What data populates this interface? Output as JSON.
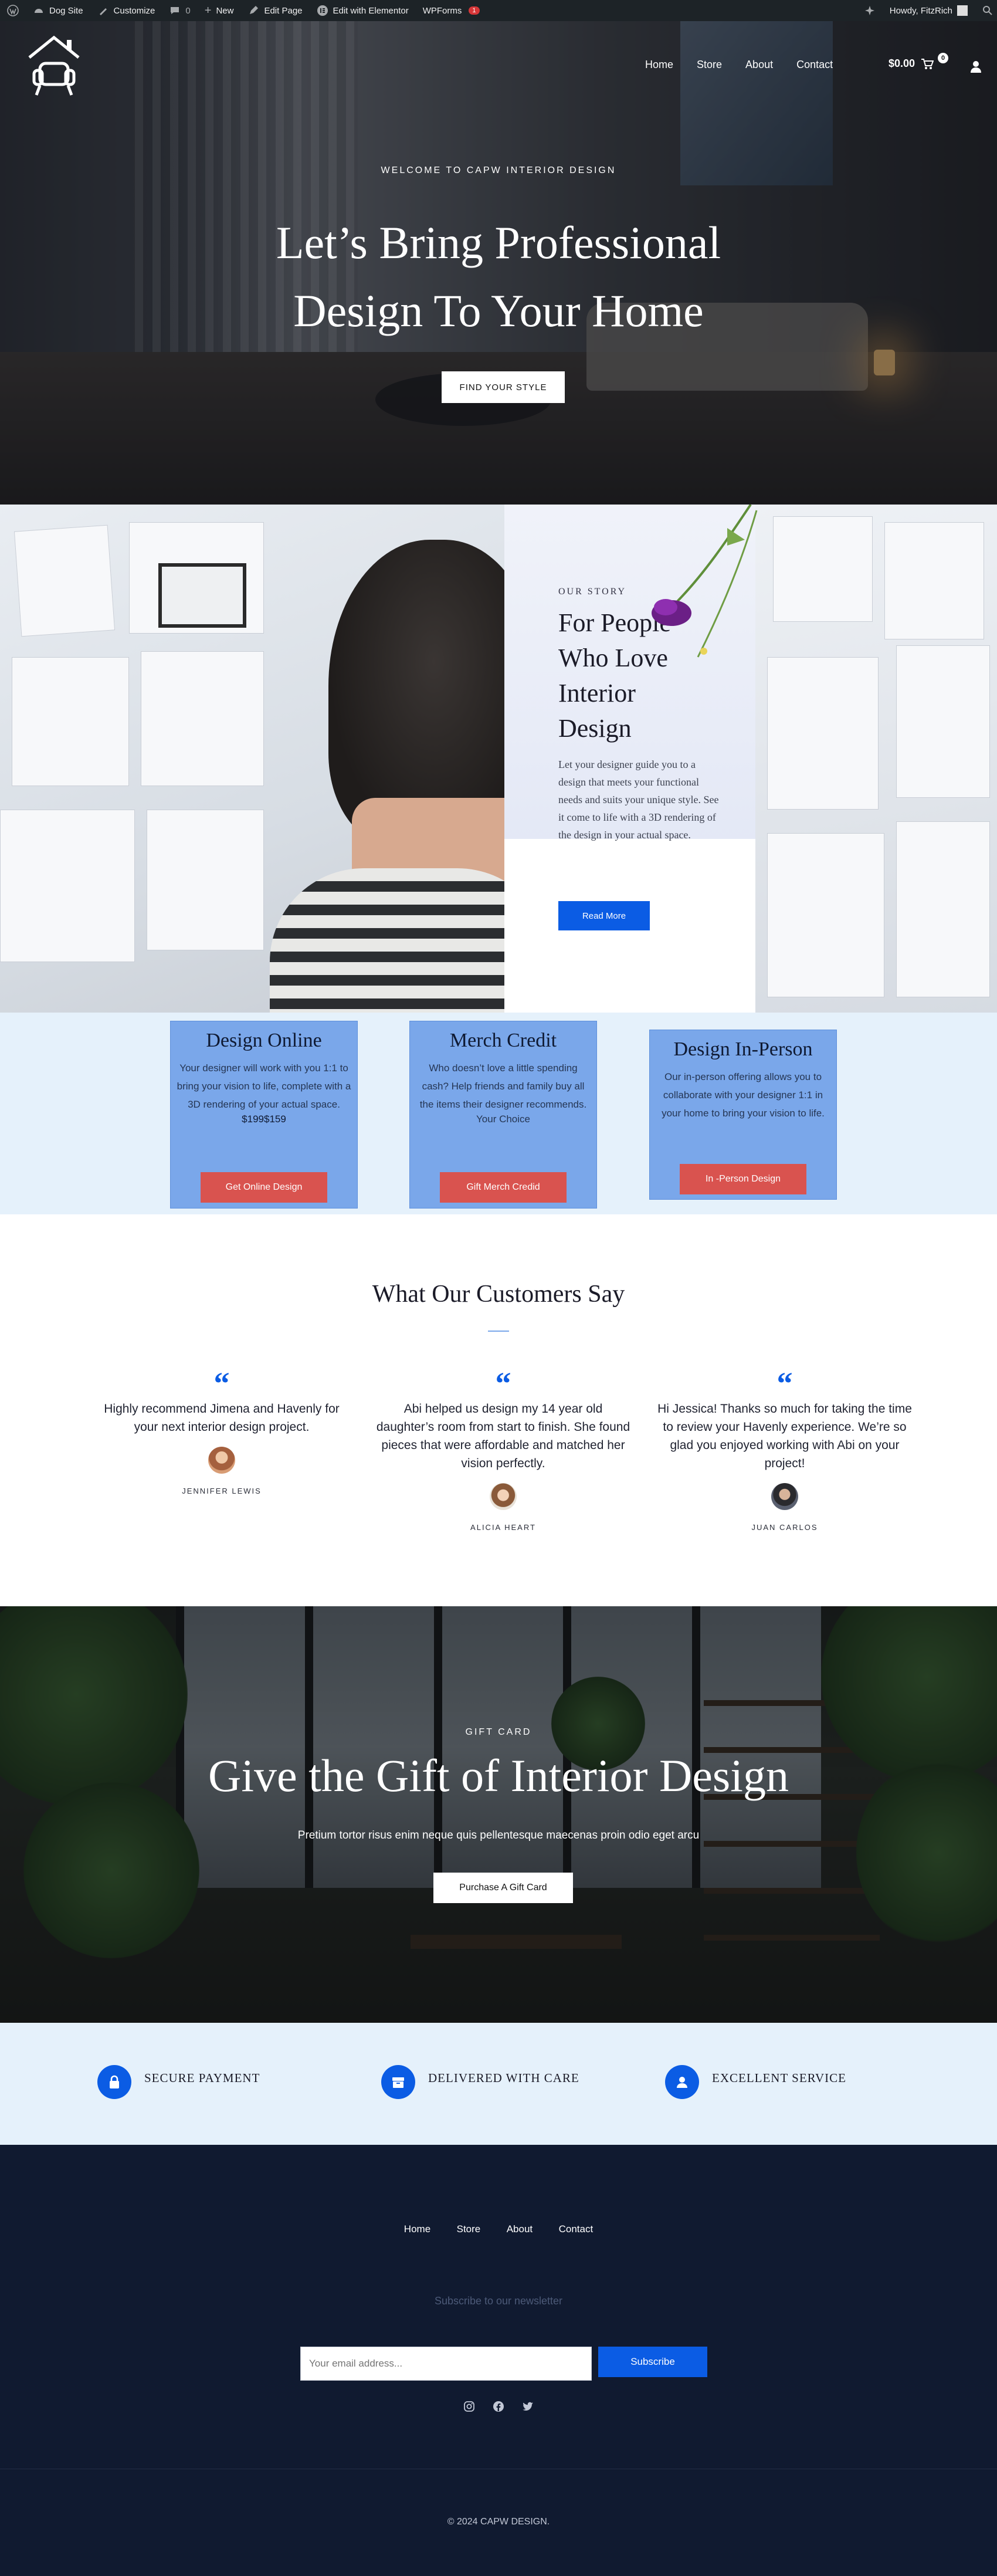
{
  "adminbar": {
    "site": "Dog Site",
    "customize": "Customize",
    "comments": "0",
    "new": "New",
    "edit_page": "Edit Page",
    "elementor": "Edit with Elementor",
    "wpforms": "WPForms",
    "wpforms_badge": "1",
    "howdy": "Howdy, FitzRich"
  },
  "header": {
    "nav": [
      "Home",
      "Store",
      "About",
      "Contact"
    ],
    "cart_total": "$0.00",
    "cart_count": "0"
  },
  "hero": {
    "kicker": "WELCOME TO CAPW INTERIOR DESIGN",
    "title_line1": "Let’s Bring Professional",
    "title_line2": "Design To Your Home",
    "button": "FIND YOUR STYLE"
  },
  "story": {
    "kicker": "OUR STORY",
    "title": "For People Who Love Interior Design",
    "text": "Let your designer guide you to a design that meets your functional needs and suits your unique style. See it come to life with a 3D rendering of the design in your actual space.",
    "button": "Read More"
  },
  "services": [
    {
      "title": "Design Online",
      "text": "Your designer will work with you 1:1 to bring your vision to life, complete with a 3D rendering of your actual space.",
      "price": "$199$159",
      "button": "Get Online Design"
    },
    {
      "title": "Merch Credit",
      "text": "Who doesn’t love a little spending cash? Help friends and family buy all the items their designer recommends.",
      "price": "Your Choice",
      "button": "Gift Merch Credid"
    },
    {
      "title": "Design In-Person",
      "text": "Our in-person offering allows you to collaborate with your designer 1:1 in your home to bring your vision to life.",
      "price": "",
      "button": "In -Person Design"
    }
  ],
  "testimonials": {
    "heading": "What Our Customers Say",
    "items": [
      {
        "quote": "Highly recommend Jimena and Havenly for your next interior design project.",
        "name": "JENNIFER LEWIS"
      },
      {
        "quote": "Abi helped us design my 14 year old daughter’s room from start to finish. She found pieces that were affordable and matched her vision perfectly.",
        "name": "ALICIA HEART"
      },
      {
        "quote": "Hi Jessica! Thanks so much for taking the time to review your Havenly experience. We’re so glad you enjoyed working with Abi on your project!",
        "name": "JUAN CARLOS"
      }
    ]
  },
  "gift": {
    "kicker": "GIFT CARD",
    "title": "Give the Gift of Interior Design",
    "subtitle": "Pretium tortor risus enim neque quis pellentesque maecenas proin odio eget arcu",
    "button": "Purchase A Gift Card"
  },
  "features": [
    "SECURE PAYMENT",
    "DELIVERED WITH CARE",
    "EXCELLENT SERVICE"
  ],
  "footer": {
    "nav": [
      "Home",
      "Store",
      "About",
      "Contact"
    ],
    "newsletter": "Subscribe to our newsletter",
    "email_placeholder": "Your email address...",
    "subscribe": "Subscribe",
    "social": [
      "instagram-icon",
      "facebook-icon",
      "twitter-icon"
    ],
    "copyright": "© 2024 CAPW DESIGN."
  },
  "colors": {
    "accent_blue": "#0b5ce4",
    "card_blue": "#7aa7ea",
    "button_red": "#d9534f",
    "footer_bg": "#101a30",
    "light_band": "#e5f1fb"
  }
}
